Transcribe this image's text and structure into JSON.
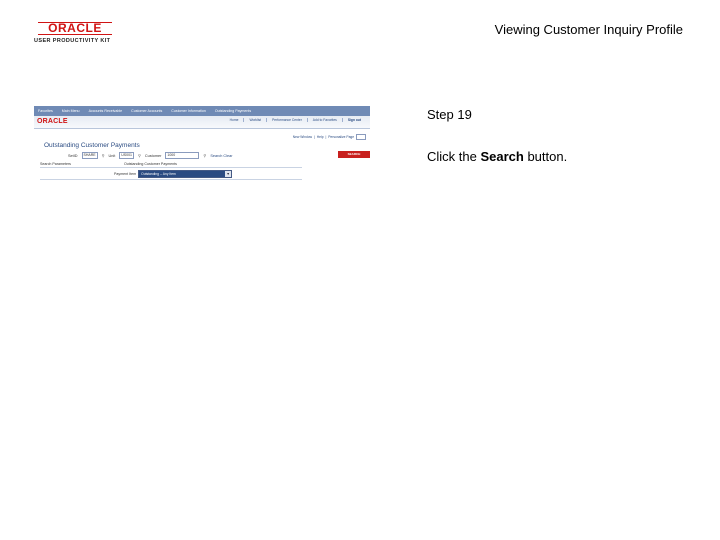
{
  "header": {
    "logo_brand": "ORACLE",
    "logo_tagline": "USER PRODUCTIVITY KIT",
    "title": "Viewing Customer Inquiry Profile"
  },
  "screenshot": {
    "nav_items": [
      "Favorites",
      "Main Menu",
      "Accounts Receivable",
      "Customer Accounts",
      "Customer Information",
      "Outstanding Payments"
    ],
    "brand": "ORACLE",
    "top_links": [
      "Home",
      "Worklist",
      "Performance Center",
      "Add to Favorites",
      "Sign out"
    ],
    "util_links": [
      "New Window",
      "Help",
      "Personalize Page"
    ],
    "page_title": "Outstanding Customer Payments",
    "form": {
      "setid_label": "SetID",
      "setid_value": "SHARE",
      "unit_label": "Unit",
      "unit_value": "US001",
      "customer_label": "Customer",
      "customer_value": "1000",
      "clear_link": "Search Clear",
      "search_button": "SEARCH"
    },
    "subheads": [
      "Search Parameters",
      "Outstanding Customer Payments"
    ],
    "select_label": "Payment Item",
    "select_value": "Outstanding -- Any Item"
  },
  "step": {
    "label": "Step 19",
    "instruction_prefix": "Click the ",
    "instruction_bold": "Search",
    "instruction_suffix": " button."
  },
  "colors": {
    "oracle_red": "#d01414",
    "nav_blue": "#6f8ab5",
    "link_blue": "#2a4b82",
    "search_button": "#c8201e"
  }
}
